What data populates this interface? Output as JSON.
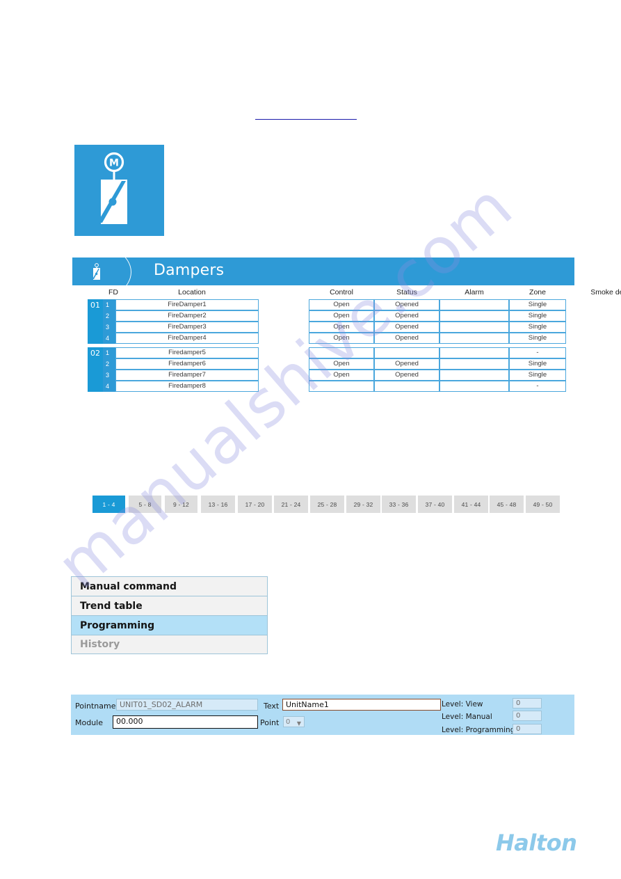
{
  "page": {
    "watermark_text": "manualshive.com",
    "background_color": "#ffffff",
    "accent_color": "#2e9ad6"
  },
  "icon_tile": {
    "icon": "motorised-damper-icon"
  },
  "panel": {
    "icon": "damper-icon",
    "title": "Dampers"
  },
  "table": {
    "headers": {
      "fd": "FD",
      "location": "Location",
      "control": "Control",
      "status": "Status",
      "alarm": "Alarm",
      "zone": "Zone",
      "smoke_detector": "Smoke detector"
    },
    "groups": [
      {
        "id": "01",
        "rows": [
          {
            "idx": "1",
            "location": "FireDamper1",
            "control": "Open",
            "status": "Opened",
            "alarm": "",
            "zone": "Single"
          },
          {
            "idx": "2",
            "location": "FireDamper2",
            "control": "Open",
            "status": "Opened",
            "alarm": "",
            "zone": "Single"
          },
          {
            "idx": "3",
            "location": "FireDamper3",
            "control": "Open",
            "status": "Opened",
            "alarm": "",
            "zone": "Single"
          },
          {
            "idx": "4",
            "location": "FireDamper4",
            "control": "Open",
            "status": "Opened",
            "alarm": "",
            "zone": "Single"
          }
        ]
      },
      {
        "id": "02",
        "rows": [
          {
            "idx": "1",
            "location": "Firedamper5",
            "control": "",
            "status": "",
            "alarm": "",
            "zone": "-"
          },
          {
            "idx": "2",
            "location": "Firedamper6",
            "control": "Open",
            "status": "Opened",
            "alarm": "",
            "zone": "Single"
          },
          {
            "idx": "3",
            "location": "Firedamper7",
            "control": "Open",
            "status": "Opened",
            "alarm": "",
            "zone": "Single"
          },
          {
            "idx": "4",
            "location": "Firedamper8",
            "control": "",
            "status": "",
            "alarm": "",
            "zone": "-"
          }
        ]
      }
    ]
  },
  "pagination": {
    "active_index": 0,
    "buttons": [
      "1 - 4",
      "5 - 8",
      "9 - 12",
      "13 - 16",
      "17 - 20",
      "21 - 24",
      "25 - 28",
      "29 - 32",
      "33 - 36",
      "37 - 40",
      "41 - 44",
      "45 - 48",
      "49 - 50"
    ]
  },
  "menu": {
    "items": [
      {
        "label": "Manual command",
        "state": "normal"
      },
      {
        "label": "Trend table",
        "state": "normal"
      },
      {
        "label": "Programming",
        "state": "highlight"
      },
      {
        "label": "History",
        "state": "disabled"
      }
    ]
  },
  "form": {
    "pointname_label": "Pointname",
    "pointname_value": "UNIT01_SD02_ALARM",
    "module_label": "Module",
    "module_value": "00.000",
    "text_label": "Text",
    "text_value": "UnitName1",
    "point_label": "Point",
    "point_value": "0",
    "point_caret": "▼",
    "levels": [
      {
        "label": "Level: View",
        "value": "0"
      },
      {
        "label": "Level: Manual",
        "value": "0"
      },
      {
        "label": "Level: Programming",
        "value": "0"
      }
    ]
  },
  "footer": {
    "logo_text": "Halton"
  }
}
